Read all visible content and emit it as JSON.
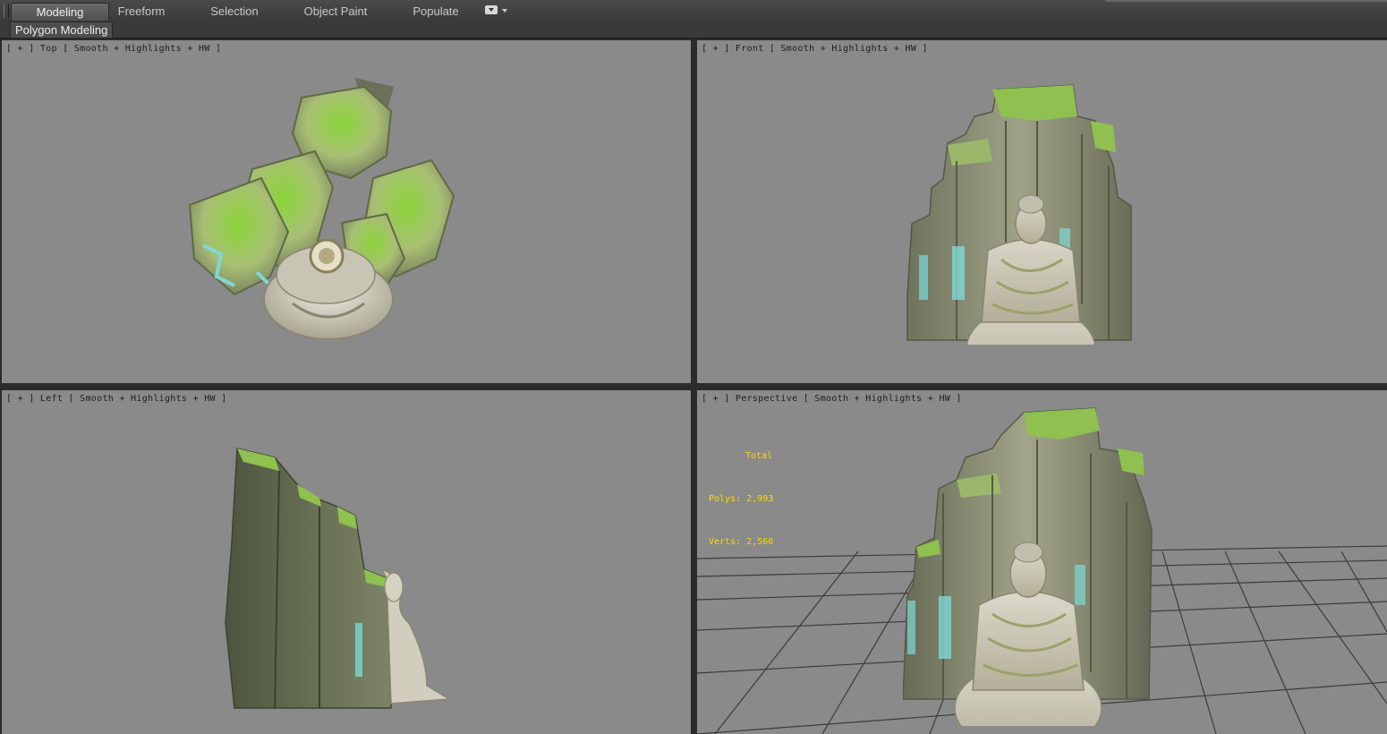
{
  "ribbon": {
    "tabs": [
      {
        "label": "Modeling",
        "active": true
      },
      {
        "label": "Freeform",
        "active": false
      },
      {
        "label": "Selection",
        "active": false
      },
      {
        "label": "Object Paint",
        "active": false
      },
      {
        "label": "Populate",
        "active": false
      }
    ],
    "more_icon": "dropdown-more-icon"
  },
  "subpanel": {
    "active_label": "Polygon Modeling"
  },
  "viewports": {
    "top": {
      "label": "[ + ] Top [ Smooth + Highlights + HW ]"
    },
    "front": {
      "label": "[ + ] Front [ Smooth + Highlights + HW ]"
    },
    "left": {
      "label": "[ + ] Left [ Smooth + Highlights + HW ]"
    },
    "perspective": {
      "label": "[ + ] Perspective [ Smooth + Highlights + HW ]",
      "stats": {
        "title": "Total",
        "polys": "Polys: 2,993",
        "verts": "Verts: 2,560"
      }
    }
  },
  "colors": {
    "viewport_bg": "#8a8a8a",
    "stats_text": "#ffd700",
    "moss": "#7fb23a",
    "rock": "#8e9178",
    "water": "#7ed8d6",
    "statue": "#d8d4c4"
  }
}
